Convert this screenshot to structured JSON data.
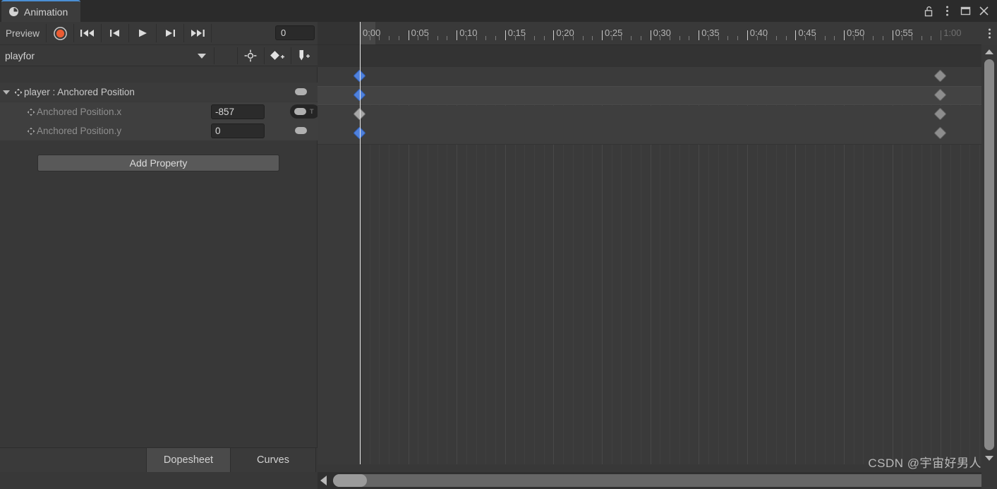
{
  "window": {
    "tab_title": "Animation",
    "tab_icon": "clock-icon",
    "controls": [
      {
        "name": "lock-icon",
        "label": "Lock"
      },
      {
        "name": "kebab-menu-icon",
        "label": "Menu"
      },
      {
        "name": "maximize-icon",
        "label": "Maximize"
      },
      {
        "name": "close-icon",
        "label": "Close"
      }
    ],
    "accent_color": "#4a8fd4",
    "background_color": "#383838"
  },
  "toolbar": {
    "preview_label": "Preview",
    "record_button": "record-keyframes-button",
    "first_frame_button": "first-keyframe-button",
    "prev_frame_button": "previous-keyframe-button",
    "play_button": "play-button",
    "next_frame_button": "next-keyframe-button",
    "last_frame_button": "last-keyframe-button",
    "frame_field_value": "0",
    "frame_field_placeholder": "0",
    "record_color": "#eb5c33"
  },
  "clip_row": {
    "selected_clip": "playfor",
    "dropdown_icon": "chevron-down-icon",
    "filter_button": "filter-by-selection-button",
    "add_keyframe_button": "add-keyframe-button",
    "add_event_button": "add-event-button"
  },
  "properties": {
    "group": {
      "label": "player : Anchored Position",
      "foldout_icon": "chevron-down-icon",
      "drag_icon": "drag-handle-icon",
      "toggle_icon": "curve-toggle-icon"
    },
    "rows": [
      {
        "label": "Anchored Position.x",
        "value": "-857",
        "drag_icon": "drag-handle-icon",
        "toggle_icon": "curve-toggle-icon",
        "toggle_extra": "T",
        "highlighted": true
      },
      {
        "label": "Anchored Position.y",
        "value": "0",
        "drag_icon": "drag-handle-icon",
        "toggle_icon": "curve-toggle-icon",
        "toggle_extra": "",
        "highlighted": false
      }
    ],
    "add_property_label": "Add Property"
  },
  "timeline": {
    "ruler_labels": [
      {
        "text": "0:00",
        "dim": false
      },
      {
        "text": "0:05",
        "dim": false
      },
      {
        "text": "0:10",
        "dim": false
      },
      {
        "text": "0:15",
        "dim": false
      },
      {
        "text": "0:20",
        "dim": false
      },
      {
        "text": "0:25",
        "dim": false
      },
      {
        "text": "0:30",
        "dim": false
      },
      {
        "text": "0:35",
        "dim": false
      },
      {
        "text": "0:40",
        "dim": false
      },
      {
        "text": "0:45",
        "dim": false
      },
      {
        "text": "0:50",
        "dim": false
      },
      {
        "text": "0:55",
        "dim": false
      },
      {
        "text": "1:00",
        "dim": true
      }
    ],
    "playhead_time": "0:00",
    "kebab_icon": "kebab-menu-icon",
    "keyframe_selected_color": "#4f81dd",
    "keyframe_unselected_color": "#a8a8a8"
  },
  "dopesheet": {
    "tracks": [
      {
        "name": "summary-track",
        "keys": [
          {
            "time": "0:00",
            "selected": true
          },
          {
            "time": "1:00",
            "selected": false
          }
        ]
      },
      {
        "name": "player-anchored-position-track",
        "keys": [
          {
            "time": "0:00",
            "selected": true
          },
          {
            "time": "1:00",
            "selected": false
          }
        ]
      },
      {
        "name": "anchored-position-x-track",
        "keys": [
          {
            "time": "0:00",
            "selected": false
          },
          {
            "time": "1:00",
            "selected": false
          }
        ]
      },
      {
        "name": "anchored-position-y-track",
        "keys": [
          {
            "time": "0:00",
            "selected": true
          },
          {
            "time": "1:00",
            "selected": false
          }
        ]
      }
    ]
  },
  "bottom_tabs": {
    "dopesheet_label": "Dopesheet",
    "curves_label": "Curves",
    "active": "Dopesheet"
  },
  "scrollbars": {
    "vertical_up_icon": "chevron-up-icon",
    "vertical_down_icon": "chevron-down-icon",
    "horizontal_left_icon": "chevron-left-icon"
  },
  "watermark": {
    "text": "CSDN @宇宙好男人"
  }
}
